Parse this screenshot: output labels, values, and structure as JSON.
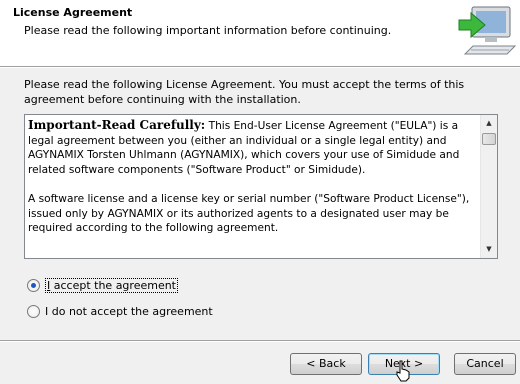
{
  "header": {
    "title": "License Agreement",
    "subtitle": "Please read the following important information before continuing.",
    "icon": "computer-install-icon"
  },
  "intro_text": "Please read the following License Agreement. You must accept the terms of this agreement before continuing with the installation.",
  "license": {
    "heading": "Important-Read Carefully:",
    "paragraph1_rest": " This End-User License Agreement (\"EULA\") is a legal agreement between you (either an individual or a single legal entity) and AGYNAMIX Torsten Uhlmann (AGYNAMIX), which covers your use of Simidude and related software components (\"Software Product\" or Simidude).",
    "paragraph2": "A software license and a license key or serial number (\"Software Product License\"), issued only by AGYNAMIX or its authorized agents to a designated user may be required according to the following agreement."
  },
  "options": {
    "accept_accel": "I",
    "accept_rest": " accept the agreement",
    "decline_label": "I do not accept the agreement",
    "selected": "accept"
  },
  "buttons": {
    "back": "< Back",
    "next": "Next >",
    "cancel": "Cancel"
  },
  "colors": {
    "accent": "#1b58c4",
    "dialog_bg": "#f0f0f0",
    "arrow_green": "#3cb93c"
  }
}
